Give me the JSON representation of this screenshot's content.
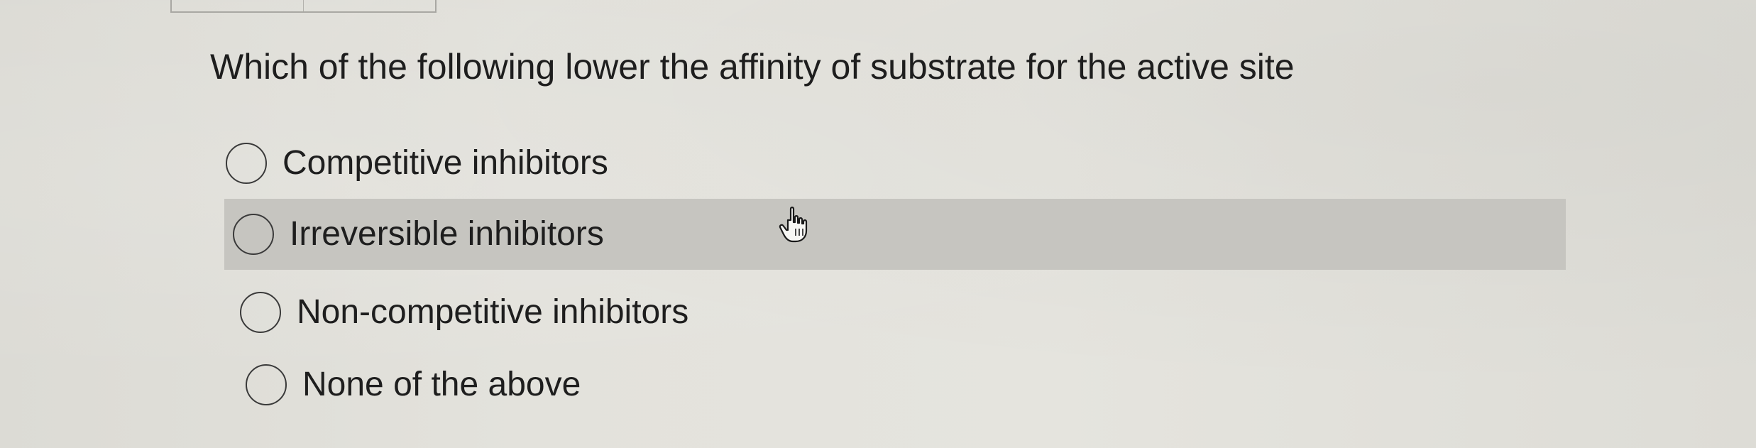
{
  "question": {
    "text": "Which of the following lower the affinity of substrate for the active site"
  },
  "options": [
    {
      "label": "Competitive inhibitors",
      "selected": false,
      "hovered": false
    },
    {
      "label": "Irreversible inhibitors",
      "selected": false,
      "hovered": true
    },
    {
      "label": "Non-competitive inhibitors",
      "selected": false,
      "hovered": false
    },
    {
      "label": "None of the above",
      "selected": false,
      "hovered": false
    }
  ],
  "cursor": {
    "icon": "hand-pointer-icon"
  },
  "colors": {
    "hover_background": "#c6c5c0",
    "page_background": "#e3e2dc",
    "text": "#1e1e1e"
  }
}
